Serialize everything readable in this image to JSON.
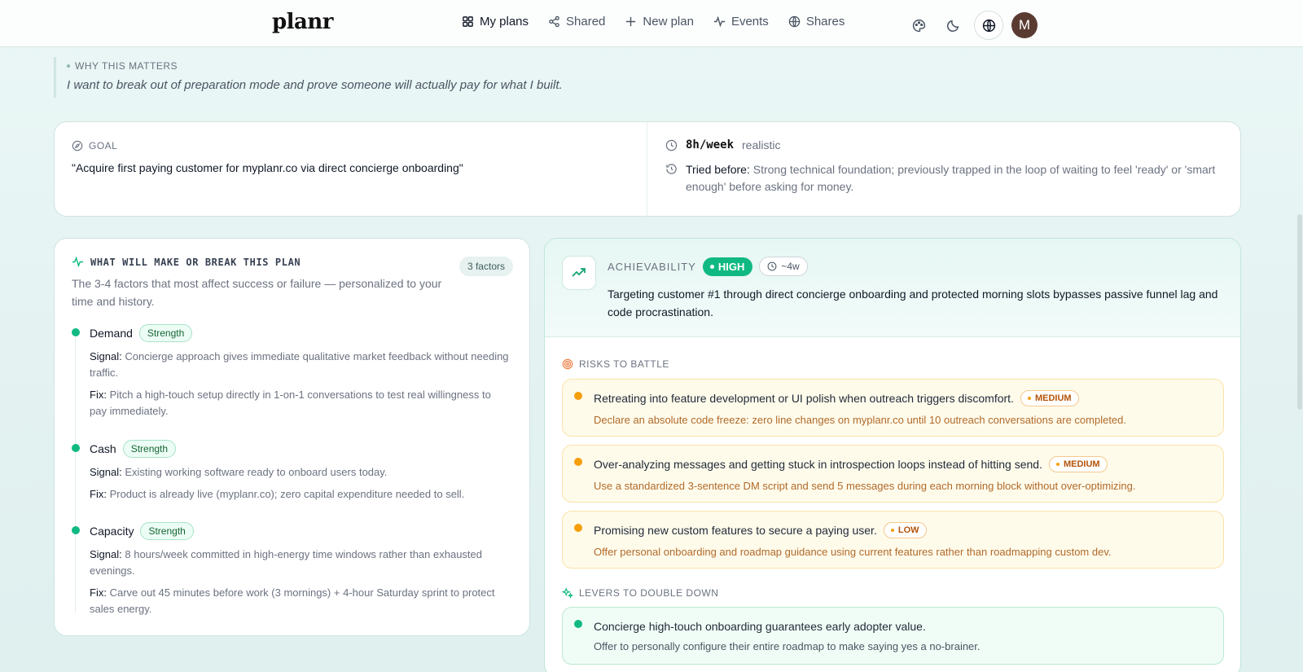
{
  "app": {
    "logo": "planr"
  },
  "nav": {
    "my_plans": "My plans",
    "shared": "Shared",
    "new_plan": "New plan",
    "events": "Events",
    "shares": "Shares"
  },
  "user": {
    "avatar_initial": "M"
  },
  "why": {
    "label": "WHY THIS MATTERS",
    "text": "I want to break out of preparation mode and prove someone will actually pay for what I built."
  },
  "goal": {
    "label": "GOAL",
    "text": "\"Acquire first paying customer for myplanr.co via direct concierge onboarding\"",
    "time_value": "8h/week",
    "time_note": "realistic",
    "tried_label": "Tried before:",
    "tried_text": "Strong technical foundation; previously trapped in the loop of waiting to feel 'ready' or 'smart enough' before asking for money."
  },
  "factors": {
    "title": "WHAT WILL MAKE OR BREAK THIS PLAN",
    "count": "3 factors",
    "subtitle": "The 3-4 factors that most affect success or failure — personalized to your time and history.",
    "signal_label": "Signal:",
    "fix_label": "Fix:",
    "items": [
      {
        "name": "Demand",
        "tag": "Strength",
        "signal": "Concierge approach gives immediate qualitative market feedback without needing traffic.",
        "fix": "Pitch a high-touch setup directly in 1-on-1 conversations to test real willingness to pay immediately."
      },
      {
        "name": "Cash",
        "tag": "Strength",
        "signal": "Existing working software ready to onboard users today.",
        "fix": "Product is already live (myplanr.co); zero capital expenditure needed to sell."
      },
      {
        "name": "Capacity",
        "tag": "Strength",
        "signal": "8 hours/week committed in high-energy time windows rather than exhausted evenings.",
        "fix": "Carve out 45 minutes before work (3 mornings) + 4-hour Saturday sprint to protect sales energy."
      }
    ]
  },
  "achievability": {
    "label": "ACHIEVABILITY",
    "level": "HIGH",
    "duration": "~4w",
    "summary": "Targeting customer #1 through direct concierge onboarding and protected morning slots bypasses passive funnel lag and code procrastination.",
    "risks_label": "RISKS TO BATTLE",
    "risks": [
      {
        "title": "Retreating into feature development or UI polish when outreach triggers discomfort.",
        "severity": "MEDIUM",
        "fix": "Declare an absolute code freeze: zero line changes on myplanr.co until 10 outreach conversations are completed."
      },
      {
        "title": "Over-analyzing messages and getting stuck in introspection loops instead of hitting send.",
        "severity": "MEDIUM",
        "fix": "Use a standardized 3-sentence DM script and send 5 messages during each morning block without over-optimizing."
      },
      {
        "title": "Promising new custom features to secure a paying user.",
        "severity": "LOW",
        "fix": "Offer personal onboarding and roadmap guidance using current features rather than roadmapping custom dev."
      }
    ],
    "levers_label": "LEVERS TO DOUBLE DOWN",
    "levers": [
      {
        "title": "Concierge high-touch onboarding guarantees early adopter value.",
        "fix": "Offer to personally configure their entire roadmap to make saying yes a no-brainer."
      }
    ]
  },
  "colors": {
    "accent_green": "#10b981",
    "risk_amber": "#f59e0b",
    "avatar_bg": "#5a3b32"
  },
  "icons": [
    "grid-icon",
    "share-icon",
    "plus-icon",
    "activity-icon",
    "globe-icon",
    "palette-icon",
    "moon-icon",
    "compass-icon",
    "clock-icon",
    "history-icon",
    "trending-up-icon",
    "target-icon",
    "sparkles-icon"
  ]
}
